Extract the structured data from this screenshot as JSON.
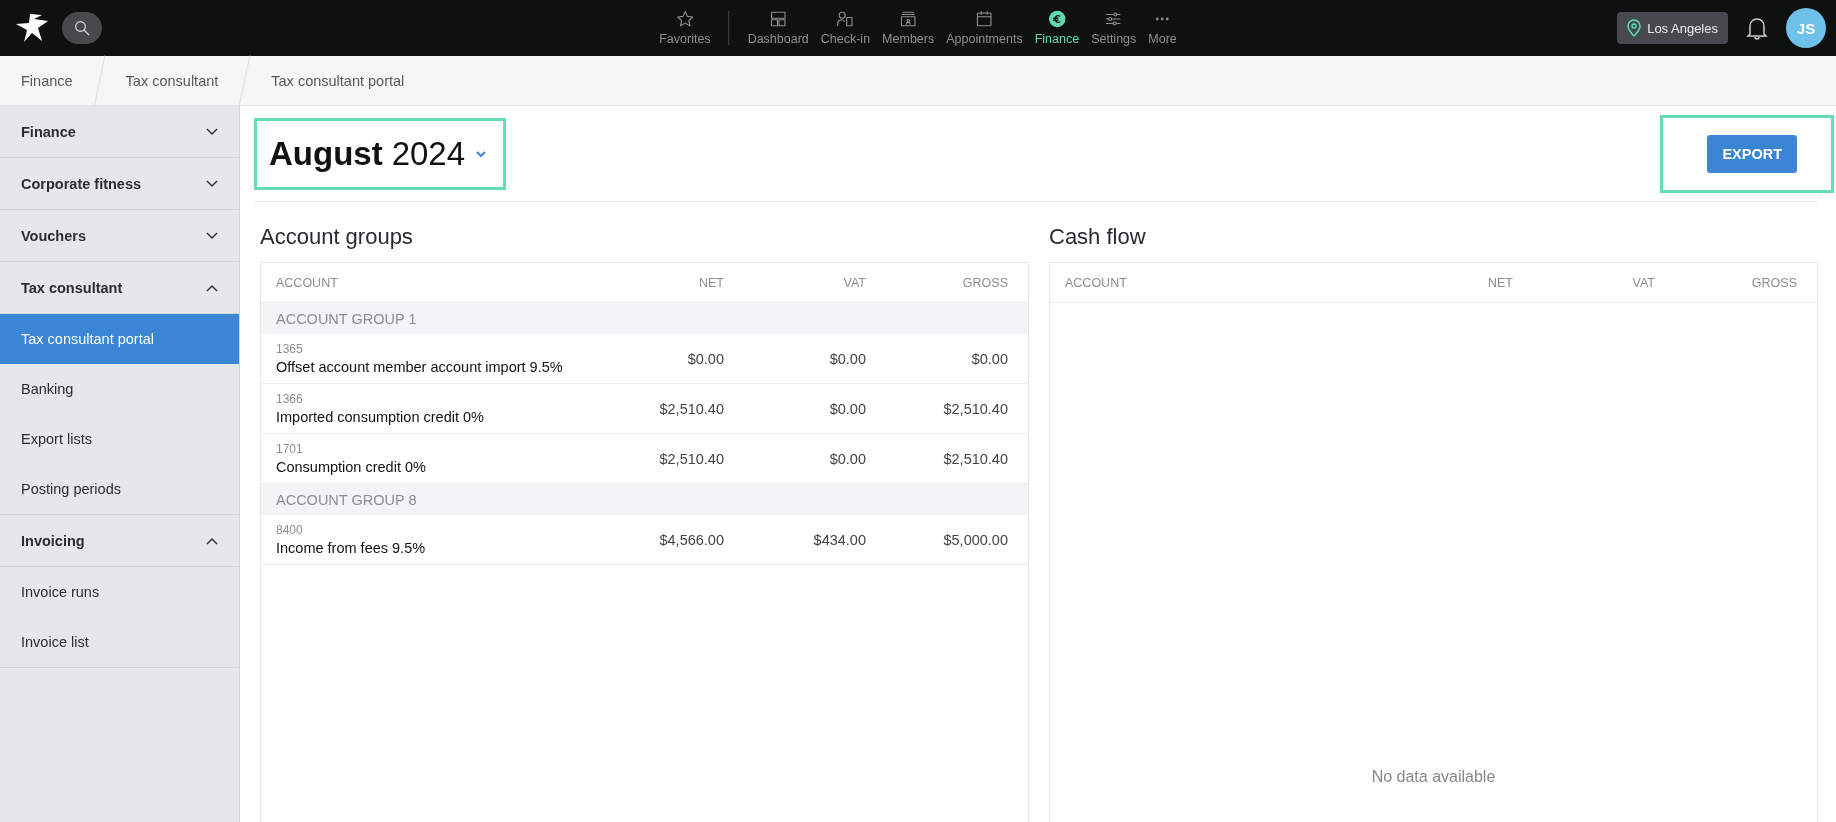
{
  "topbar": {
    "nav": [
      {
        "label": "Favorites",
        "selected": false
      },
      {
        "label": "Dashboard",
        "selected": false
      },
      {
        "label": "Check-in",
        "selected": false
      },
      {
        "label": "Members",
        "selected": false
      },
      {
        "label": "Appointments",
        "selected": false
      },
      {
        "label": "Finance",
        "selected": true
      },
      {
        "label": "Settings",
        "selected": false
      },
      {
        "label": "More",
        "selected": false
      }
    ],
    "location": "Los Angeles",
    "avatar": "JS"
  },
  "breadcrumbs": [
    "Finance",
    "Tax consultant",
    "Tax consultant portal"
  ],
  "sidebar": {
    "sections": [
      {
        "label": "Finance",
        "expanded": false
      },
      {
        "label": "Corporate fitness",
        "expanded": false
      },
      {
        "label": "Vouchers",
        "expanded": false
      },
      {
        "label": "Tax consultant",
        "expanded": true,
        "children": [
          {
            "label": "Tax consultant portal",
            "selected": true
          },
          {
            "label": "Banking",
            "selected": false
          },
          {
            "label": "Export lists",
            "selected": false
          },
          {
            "label": "Posting periods",
            "selected": false
          }
        ]
      },
      {
        "label": "Invoicing",
        "expanded": true,
        "children": [
          {
            "label": "Invoice runs",
            "selected": false
          },
          {
            "label": "Invoice list",
            "selected": false
          }
        ]
      }
    ]
  },
  "period": {
    "month": "August",
    "year": "2024",
    "highlighted": true
  },
  "export_button": {
    "label": "EXPORT",
    "highlighted": true
  },
  "panels": [
    {
      "title": "Account groups",
      "columns": [
        "ACCOUNT",
        "NET",
        "VAT",
        "GROSS"
      ],
      "rows": [
        {
          "kind": "group",
          "label": "ACCOUNT GROUP 1"
        },
        {
          "kind": "account",
          "number": "1365",
          "name": "Offset account member account import 9.5%",
          "net": "$0.00",
          "vat": "$0.00",
          "gross": "$0.00"
        },
        {
          "kind": "account",
          "number": "1366",
          "name": "Imported consumption credit 0%",
          "net": "$2,510.40",
          "vat": "$0.00",
          "gross": "$2,510.40"
        },
        {
          "kind": "account",
          "number": "1701",
          "name": "Consumption credit 0%",
          "net": "$2,510.40",
          "vat": "$0.00",
          "gross": "$2,510.40"
        },
        {
          "kind": "group",
          "label": "ACCOUNT GROUP 8"
        },
        {
          "kind": "account",
          "number": "8400",
          "name": "Income from fees 9.5%",
          "net": "$4,566.00",
          "vat": "$434.00",
          "gross": "$5,000.00"
        }
      ]
    },
    {
      "title": "Cash flow",
      "columns": [
        "ACCOUNT",
        "NET",
        "VAT",
        "GROSS"
      ],
      "empty_text": "No data available"
    }
  ]
}
